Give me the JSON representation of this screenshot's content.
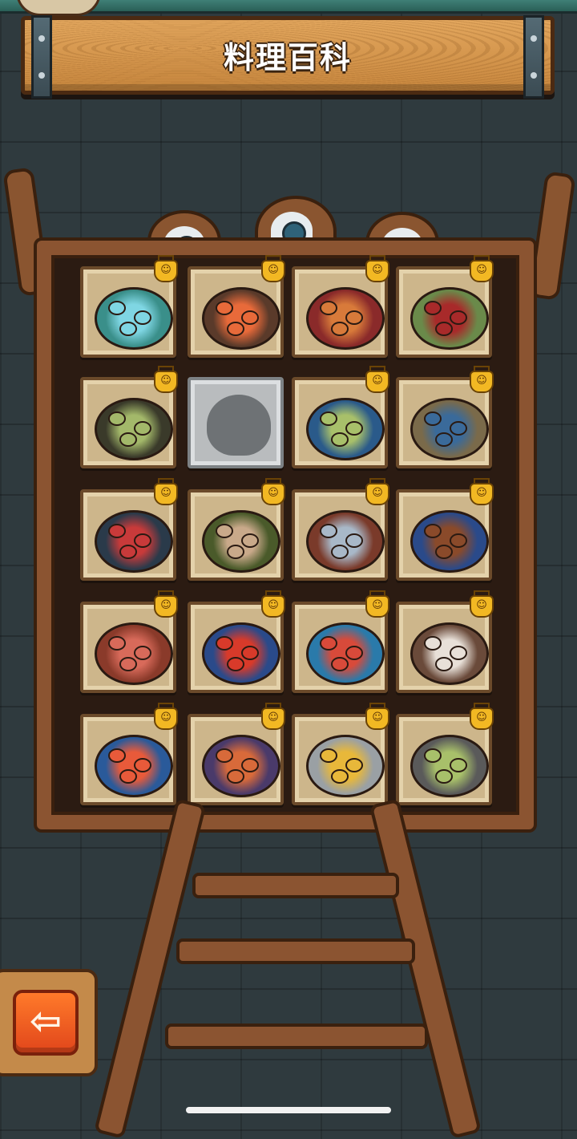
{
  "header": {
    "title": "料理百科"
  },
  "badge_icon": "happy-face-badge-icon",
  "collection": {
    "columns": 4,
    "rows": [
      [
        {
          "name": "blue-flame-grilled-fish",
          "locked": false,
          "color": "#3a8f8a",
          "accent": "#7fd6e3"
        },
        {
          "name": "sushi-platter",
          "locked": false,
          "color": "#5a3a2a",
          "accent": "#e86a3a"
        },
        {
          "name": "meat-roll-plate",
          "locked": false,
          "color": "#8a2a2a",
          "accent": "#d87a3a"
        },
        {
          "name": "green-dumpling-plate",
          "locked": false,
          "color": "#6a8a4a",
          "accent": "#a82a2a"
        }
      ],
      [
        {
          "name": "green-soup-bowl",
          "locked": false,
          "color": "#3a3a2a",
          "accent": "#a3b86a"
        },
        {
          "name": "undiscovered-dish",
          "locked": true,
          "color": "#6e7275",
          "accent": "#6e7275"
        },
        {
          "name": "green-rice-dish",
          "locked": false,
          "color": "#2a5a8a",
          "accent": "#a8c06a"
        },
        {
          "name": "fish-head-soup",
          "locked": false,
          "color": "#7a6a4a",
          "accent": "#3a6a9a"
        }
      ],
      [
        {
          "name": "red-sauce-pan",
          "locked": false,
          "color": "#2a3a4a",
          "accent": "#c83a3a"
        },
        {
          "name": "rolled-fish-fillets",
          "locked": false,
          "color": "#4a5a2a",
          "accent": "#c9a98a"
        },
        {
          "name": "grilled-oysters",
          "locked": false,
          "color": "#7a3a2a",
          "accent": "#a8b8c8"
        },
        {
          "name": "braised-meat-plate",
          "locked": false,
          "color": "#2a4a8a",
          "accent": "#8a4a2a"
        }
      ],
      [
        {
          "name": "red-stew-pot",
          "locked": false,
          "color": "#8a3a2a",
          "accent": "#d86a5a"
        },
        {
          "name": "lobster-plate",
          "locked": false,
          "color": "#2a4a8a",
          "accent": "#d83a2a"
        },
        {
          "name": "crab-claw-platter",
          "locked": false,
          "color": "#2a7aaa",
          "accent": "#d84a3a"
        },
        {
          "name": "strawberry-porridge",
          "locked": false,
          "color": "#6a4a3a",
          "accent": "#e8e0d8"
        }
      ],
      [
        {
          "name": "shrimp-rice-bowl",
          "locked": false,
          "color": "#2a5a9a",
          "accent": "#e85a3a"
        },
        {
          "name": "seafood-paella",
          "locked": false,
          "color": "#4a3a6a",
          "accent": "#d86a3a"
        },
        {
          "name": "ramen-bowl",
          "locked": false,
          "color": "#9aa0a4",
          "accent": "#e8b83a"
        },
        {
          "name": "stir-fry-pan",
          "locked": false,
          "color": "#5a5a5a",
          "accent": "#a8c06a"
        }
      ]
    ]
  },
  "back_button": {
    "icon": "back-arrow-icon",
    "glyph": "⇦"
  }
}
